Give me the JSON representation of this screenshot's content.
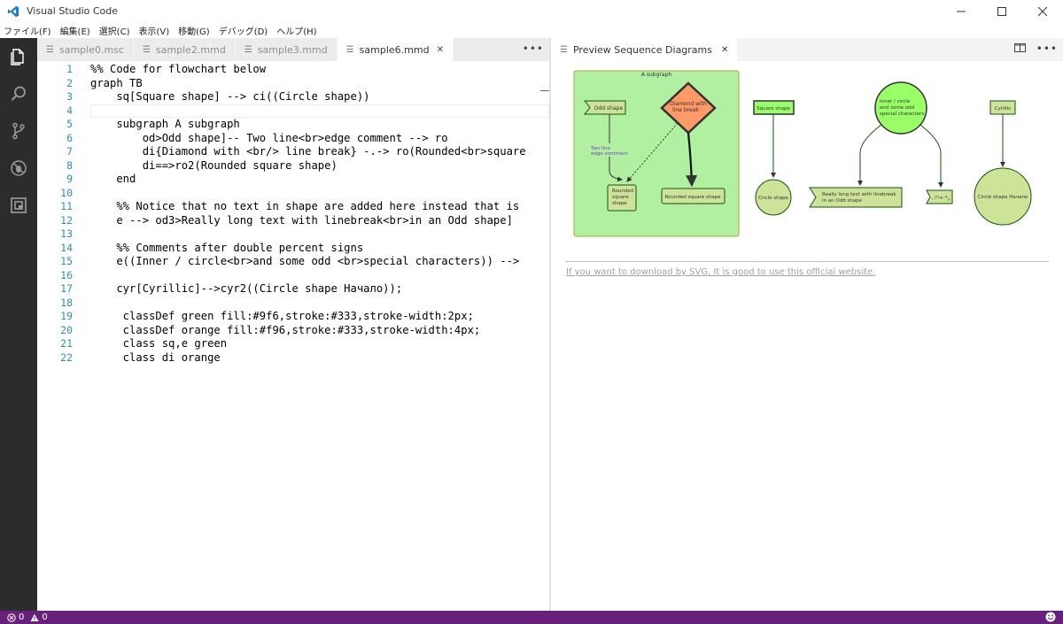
{
  "window": {
    "title": "Visual Studio Code"
  },
  "menu": [
    "ファイル(F)",
    "編集(E)",
    "選択(C)",
    "表示(V)",
    "移動(G)",
    "デバッグ(D)",
    "ヘルプ(H)"
  ],
  "editor": {
    "tabs": [
      {
        "label": "sample0.msc"
      },
      {
        "label": "sample2.mmd"
      },
      {
        "label": "sample3.mmd"
      },
      {
        "label": "sample6.mmd"
      }
    ],
    "lines": [
      {
        "n": "1",
        "code": "%% Code for flowchart below"
      },
      {
        "n": "2",
        "code": "graph TB"
      },
      {
        "n": "3",
        "code": "    sq[Square shape] --> ci((Circle shape))"
      },
      {
        "n": "4",
        "code": ""
      },
      {
        "n": "5",
        "code": "    subgraph A subgraph"
      },
      {
        "n": "6",
        "code": "        od>Odd shape]-- Two line<br>edge comment --> ro"
      },
      {
        "n": "7",
        "code": "        di{Diamond with <br/> line break} -.-> ro(Rounded<br>square"
      },
      {
        "n": "8",
        "code": "        di==>ro2(Rounded square shape)"
      },
      {
        "n": "9",
        "code": "    end"
      },
      {
        "n": "10",
        "code": ""
      },
      {
        "n": "11",
        "code": "    %% Notice that no text in shape are added here instead that is"
      },
      {
        "n": "12",
        "code": "    e --> od3>Really long text with linebreak<br>in an Odd shape]"
      },
      {
        "n": "13",
        "code": ""
      },
      {
        "n": "14",
        "code": "    %% Comments after double percent signs"
      },
      {
        "n": "15",
        "code": "    e((Inner / circle<br>and some odd <br>special characters)) -->"
      },
      {
        "n": "16",
        "code": ""
      },
      {
        "n": "17",
        "code": "    cyr[Cyrillic]-->cyr2((Circle shape Начало));"
      },
      {
        "n": "18",
        "code": ""
      },
      {
        "n": "19",
        "code": "     classDef green fill:#9f6,stroke:#333,stroke-width:2px;"
      },
      {
        "n": "20",
        "code": "     classDef orange fill:#f96,stroke:#333,stroke-width:4px;"
      },
      {
        "n": "21",
        "code": "     class sq,e green"
      },
      {
        "n": "22",
        "code": "     class di orange"
      }
    ]
  },
  "preview": {
    "tab_label": "Preview Sequence Diagrams",
    "diagram": {
      "subgraph_title": "A subgraph",
      "odd_shape": "Odd shape",
      "diamond": [
        "Diamond with",
        "line break"
      ],
      "edge_comment": [
        "Two line",
        "edge comment"
      ],
      "rounded_square": [
        "Rounded",
        "square",
        "shape"
      ],
      "rounded_square_shape": "Rounded square shape",
      "square_shape": "Square shape",
      "circle_shape": "Circle shape",
      "inner_circle": [
        "Inner / circle",
        "and some odd",
        "special characters"
      ],
      "long_text": [
        "Really long text with linebreak",
        "in an Odd shape"
      ],
      "special_chars": ",.?!+-*ز",
      "cyrillic": "Cyrillic",
      "cyrillic_circle": "Circle shape Начало"
    },
    "download_link": "If you want to download by SVG, It is good to use this official website."
  },
  "status": {
    "errors": "0",
    "warnings": "0"
  },
  "colors": {
    "activity_bar": "#2c2c2c",
    "status_bar": "#68217a",
    "line_numbers": "#2b91af",
    "subgraph_fill": "#b0f0a0",
    "green_fill": "#99ff66",
    "orange_fill": "#ff9966",
    "node_fill": "#cde498"
  }
}
